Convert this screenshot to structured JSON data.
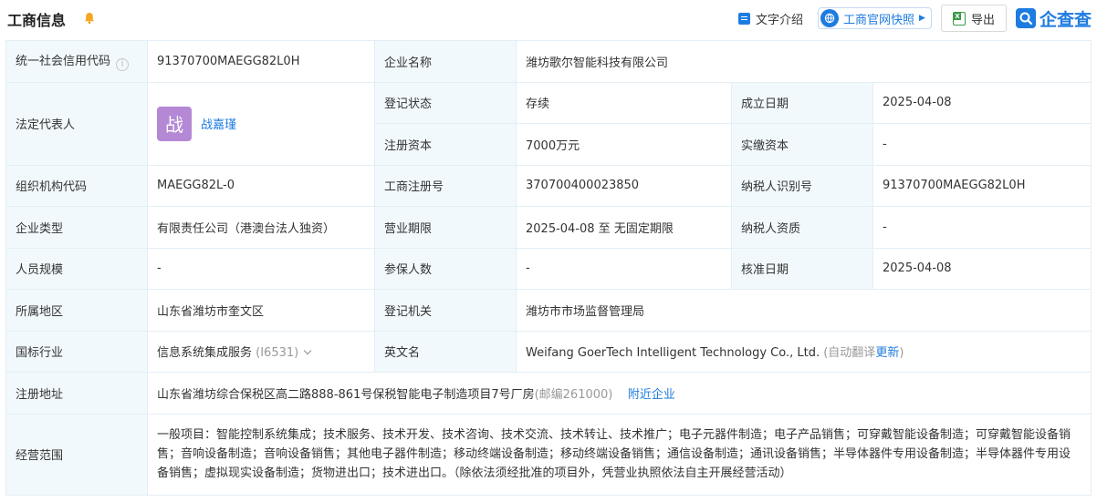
{
  "header": {
    "title": "工商信息",
    "text_intro": "文字介绍",
    "gs_snapshot": "工商官网快照",
    "export": "导出",
    "logo_text": "企查查"
  },
  "colors": {
    "accent": "#1e7ce0",
    "label_bg": "#f2f9fc",
    "avatar_bg": "#b588d6",
    "bell": "#f5a623"
  },
  "icons": [
    "bell-icon",
    "document-icon",
    "globe-icon",
    "excel-icon",
    "logo-icon",
    "help-icon",
    "chevron-down-icon"
  ],
  "rows": {
    "credit_code": {
      "label": "统一社会信用代码",
      "value": "91370700MAEGG82L0H"
    },
    "company_name": {
      "label": "企业名称",
      "value": "潍坊歌尔智能科技有限公司"
    },
    "legal_rep": {
      "label": "法定代表人",
      "avatar_char": "战",
      "name": "战嘉瑾"
    },
    "reg_status": {
      "label": "登记状态",
      "value": "存续"
    },
    "founded": {
      "label": "成立日期",
      "value": "2025-04-08"
    },
    "reg_capital": {
      "label": "注册资本",
      "value": "7000万元"
    },
    "paid_capital": {
      "label": "实缴资本",
      "value": "-"
    },
    "org_code": {
      "label": "组织机构代码",
      "value": "MAEGG82L-0"
    },
    "biz_reg_no": {
      "label": "工商注册号",
      "value": "370700400023850"
    },
    "taxpayer_id": {
      "label": "纳税人识别号",
      "value": "91370700MAEGG82L0H"
    },
    "company_type": {
      "label": "企业类型",
      "value": "有限责任公司（港澳台法人独资）"
    },
    "biz_term": {
      "label": "营业期限",
      "value": "2025-04-08 至 无固定期限"
    },
    "taxpayer_qual": {
      "label": "纳税人资质",
      "value": "-"
    },
    "staff_size": {
      "label": "人员规模",
      "value": "-"
    },
    "insured": {
      "label": "参保人数",
      "value": "-"
    },
    "approved": {
      "label": "核准日期",
      "value": "2025-04-08"
    },
    "region": {
      "label": "所属地区",
      "value": "山东省潍坊市奎文区"
    },
    "reg_authority": {
      "label": "登记机关",
      "value": "潍坊市市场监督管理局"
    },
    "industry": {
      "label": "国标行业",
      "value": "信息系统集成服务",
      "code": "(I6531)"
    },
    "english_name": {
      "label": "英文名",
      "value": "Weifang GoerTech Intelligent Technology Co., Ltd.",
      "auto_translate": "(自动翻译",
      "update": "更新",
      "close_paren": ")"
    },
    "address": {
      "label": "注册地址",
      "value": "山东省潍坊综合保税区高二路888-861号保税智能电子制造项目7号厂房",
      "postcode": "(邮编261000)",
      "nearby": "附近企业"
    },
    "scope": {
      "label": "经营范围",
      "value": "一般项目：智能控制系统集成；技术服务、技术开发、技术咨询、技术交流、技术转让、技术推广；电子元器件制造；电子产品销售；可穿戴智能设备制造；可穿戴智能设备销售；音响设备制造；音响设备销售；其他电子器件制造；移动终端设备制造；移动终端设备销售；通信设备制造；通讯设备销售；半导体器件专用设备制造；半导体器件专用设备销售；虚拟现实设备制造；货物进出口；技术进出口。（除依法须经批准的项目外，凭营业执照依法自主开展经营活动）"
    }
  }
}
